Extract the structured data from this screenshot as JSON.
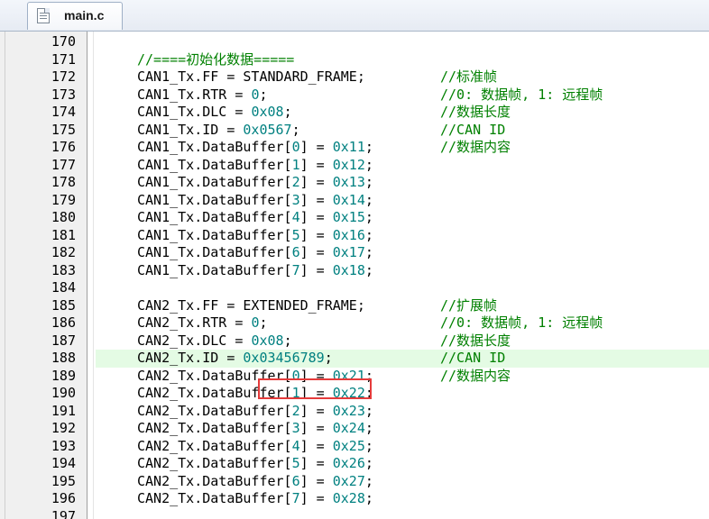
{
  "tab": {
    "label": "main.c",
    "icon": "c-file-icon"
  },
  "colors": {
    "comment": "#008000",
    "number": "#008080",
    "highlight": "#e4fbe4",
    "annotation_box": "#e53b3b"
  },
  "lines": [
    {
      "n": "170",
      "code": [],
      "comment": ""
    },
    {
      "n": "171",
      "code": [
        {
          "t": "//====初始化数据=====",
          "c": "green"
        }
      ],
      "comment": ""
    },
    {
      "n": "172",
      "code": [
        {
          "t": "CAN1_Tx.FF = STANDARD_FRAME;",
          "c": ""
        }
      ],
      "comment": "//标准帧"
    },
    {
      "n": "173",
      "code": [
        {
          "t": "CAN1_Tx.RTR = ",
          "c": ""
        },
        {
          "t": "0",
          "c": "num"
        },
        {
          "t": ";",
          "c": ""
        }
      ],
      "comment": "//0: 数据帧, 1: 远程帧"
    },
    {
      "n": "174",
      "code": [
        {
          "t": "CAN1_Tx.DLC = ",
          "c": ""
        },
        {
          "t": "0x08",
          "c": "num"
        },
        {
          "t": ";",
          "c": ""
        }
      ],
      "comment": "//数据长度"
    },
    {
      "n": "175",
      "code": [
        {
          "t": "CAN1_Tx.ID = ",
          "c": ""
        },
        {
          "t": "0x0567",
          "c": "num"
        },
        {
          "t": ";",
          "c": ""
        }
      ],
      "comment": "//CAN ID"
    },
    {
      "n": "176",
      "code": [
        {
          "t": "CAN1_Tx.DataBuffer[",
          "c": ""
        },
        {
          "t": "0",
          "c": "num"
        },
        {
          "t": "] = ",
          "c": ""
        },
        {
          "t": "0x11",
          "c": "num"
        },
        {
          "t": ";",
          "c": ""
        }
      ],
      "comment": "//数据内容"
    },
    {
      "n": "177",
      "code": [
        {
          "t": "CAN1_Tx.DataBuffer[",
          "c": ""
        },
        {
          "t": "1",
          "c": "num"
        },
        {
          "t": "] = ",
          "c": ""
        },
        {
          "t": "0x12",
          "c": "num"
        },
        {
          "t": ";",
          "c": ""
        }
      ],
      "comment": ""
    },
    {
      "n": "178",
      "code": [
        {
          "t": "CAN1_Tx.DataBuffer[",
          "c": ""
        },
        {
          "t": "2",
          "c": "num"
        },
        {
          "t": "] = ",
          "c": ""
        },
        {
          "t": "0x13",
          "c": "num"
        },
        {
          "t": ";",
          "c": ""
        }
      ],
      "comment": ""
    },
    {
      "n": "179",
      "code": [
        {
          "t": "CAN1_Tx.DataBuffer[",
          "c": ""
        },
        {
          "t": "3",
          "c": "num"
        },
        {
          "t": "] = ",
          "c": ""
        },
        {
          "t": "0x14",
          "c": "num"
        },
        {
          "t": ";",
          "c": ""
        }
      ],
      "comment": ""
    },
    {
      "n": "180",
      "code": [
        {
          "t": "CAN1_Tx.DataBuffer[",
          "c": ""
        },
        {
          "t": "4",
          "c": "num"
        },
        {
          "t": "] = ",
          "c": ""
        },
        {
          "t": "0x15",
          "c": "num"
        },
        {
          "t": ";",
          "c": ""
        }
      ],
      "comment": ""
    },
    {
      "n": "181",
      "code": [
        {
          "t": "CAN1_Tx.DataBuffer[",
          "c": ""
        },
        {
          "t": "5",
          "c": "num"
        },
        {
          "t": "] = ",
          "c": ""
        },
        {
          "t": "0x16",
          "c": "num"
        },
        {
          "t": ";",
          "c": ""
        }
      ],
      "comment": ""
    },
    {
      "n": "182",
      "code": [
        {
          "t": "CAN1_Tx.DataBuffer[",
          "c": ""
        },
        {
          "t": "6",
          "c": "num"
        },
        {
          "t": "] = ",
          "c": ""
        },
        {
          "t": "0x17",
          "c": "num"
        },
        {
          "t": ";",
          "c": ""
        }
      ],
      "comment": ""
    },
    {
      "n": "183",
      "code": [
        {
          "t": "CAN1_Tx.DataBuffer[",
          "c": ""
        },
        {
          "t": "7",
          "c": "num"
        },
        {
          "t": "] = ",
          "c": ""
        },
        {
          "t": "0x18",
          "c": "num"
        },
        {
          "t": ";",
          "c": ""
        }
      ],
      "comment": ""
    },
    {
      "n": "184",
      "code": [],
      "comment": ""
    },
    {
      "n": "185",
      "code": [
        {
          "t": "CAN2_Tx.FF = EXTENDED_FRAME;",
          "c": ""
        }
      ],
      "comment": "//扩展帧"
    },
    {
      "n": "186",
      "code": [
        {
          "t": "CAN2_Tx.RTR = ",
          "c": ""
        },
        {
          "t": "0",
          "c": "num"
        },
        {
          "t": ";",
          "c": ""
        }
      ],
      "comment": "//0: 数据帧, 1: 远程帧"
    },
    {
      "n": "187",
      "code": [
        {
          "t": "CAN2_Tx.DLC = ",
          "c": ""
        },
        {
          "t": "0x08",
          "c": "num"
        },
        {
          "t": ";",
          "c": ""
        }
      ],
      "comment": "//数据长度"
    },
    {
      "n": "188",
      "code": [
        {
          "t": "CAN2_Tx.ID = ",
          "c": ""
        },
        {
          "t": "0x03456789",
          "c": "num"
        },
        {
          "t": ";",
          "c": ""
        }
      ],
      "comment": "//CAN ID",
      "highlight": true
    },
    {
      "n": "189",
      "code": [
        {
          "t": "CAN2_Tx.DataBuffer[",
          "c": ""
        },
        {
          "t": "0",
          "c": "num"
        },
        {
          "t": "] = ",
          "c": ""
        },
        {
          "t": "0x21",
          "c": "num"
        },
        {
          "t": ";",
          "c": ""
        }
      ],
      "comment": "//数据内容"
    },
    {
      "n": "190",
      "code": [
        {
          "t": "CAN2_Tx.DataBuffer[",
          "c": ""
        },
        {
          "t": "1",
          "c": "num"
        },
        {
          "t": "] = ",
          "c": ""
        },
        {
          "t": "0x22",
          "c": "num"
        },
        {
          "t": ";",
          "c": ""
        }
      ],
      "comment": ""
    },
    {
      "n": "191",
      "code": [
        {
          "t": "CAN2_Tx.DataBuffer[",
          "c": ""
        },
        {
          "t": "2",
          "c": "num"
        },
        {
          "t": "] = ",
          "c": ""
        },
        {
          "t": "0x23",
          "c": "num"
        },
        {
          "t": ";",
          "c": ""
        }
      ],
      "comment": ""
    },
    {
      "n": "192",
      "code": [
        {
          "t": "CAN2_Tx.DataBuffer[",
          "c": ""
        },
        {
          "t": "3",
          "c": "num"
        },
        {
          "t": "] = ",
          "c": ""
        },
        {
          "t": "0x24",
          "c": "num"
        },
        {
          "t": ";",
          "c": ""
        }
      ],
      "comment": ""
    },
    {
      "n": "193",
      "code": [
        {
          "t": "CAN2_Tx.DataBuffer[",
          "c": ""
        },
        {
          "t": "4",
          "c": "num"
        },
        {
          "t": "] = ",
          "c": ""
        },
        {
          "t": "0x25",
          "c": "num"
        },
        {
          "t": ";",
          "c": ""
        }
      ],
      "comment": ""
    },
    {
      "n": "194",
      "code": [
        {
          "t": "CAN2_Tx.DataBuffer[",
          "c": ""
        },
        {
          "t": "5",
          "c": "num"
        },
        {
          "t": "] = ",
          "c": ""
        },
        {
          "t": "0x26",
          "c": "num"
        },
        {
          "t": ";",
          "c": ""
        }
      ],
      "comment": ""
    },
    {
      "n": "195",
      "code": [
        {
          "t": "CAN2_Tx.DataBuffer[",
          "c": ""
        },
        {
          "t": "6",
          "c": "num"
        },
        {
          "t": "] = ",
          "c": ""
        },
        {
          "t": "0x27",
          "c": "num"
        },
        {
          "t": ";",
          "c": ""
        }
      ],
      "comment": ""
    },
    {
      "n": "196",
      "code": [
        {
          "t": "CAN2_Tx.DataBuffer[",
          "c": ""
        },
        {
          "t": "7",
          "c": "num"
        },
        {
          "t": "] = ",
          "c": ""
        },
        {
          "t": "0x28",
          "c": "num"
        },
        {
          "t": ";",
          "c": ""
        }
      ],
      "comment": ""
    },
    {
      "n": "197",
      "code": [],
      "comment": ""
    }
  ]
}
